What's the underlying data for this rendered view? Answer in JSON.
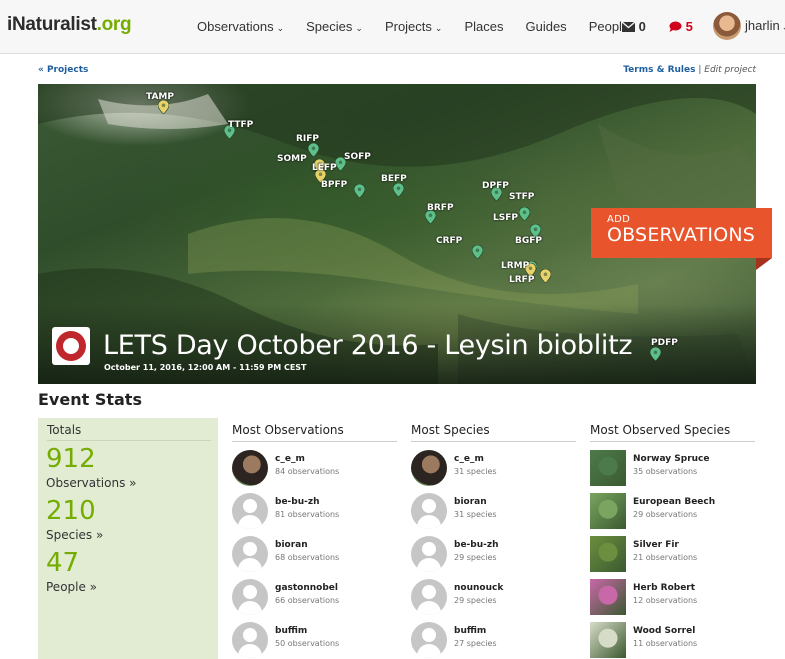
{
  "nav": {
    "logo_main": "iNaturalist",
    "logo_org": ".org",
    "menu": [
      {
        "label": "Observations",
        "dropdown": true
      },
      {
        "label": "Species",
        "dropdown": true
      },
      {
        "label": "Projects",
        "dropdown": true
      },
      {
        "label": "Places",
        "dropdown": false
      },
      {
        "label": "Guides",
        "dropdown": false
      },
      {
        "label": "People",
        "dropdown": false
      }
    ],
    "messages_count": "0",
    "notifications_count": "5",
    "username": "jharlin",
    "caret": "⌄"
  },
  "subnav": {
    "back_link": "« Projects",
    "terms": "Terms & Rules",
    "separator": "|",
    "edit": "Edit project"
  },
  "banner": {
    "pins": [
      {
        "label": "TAMP",
        "color": "#e8d36a"
      },
      {
        "label": "TTFP",
        "color": "#5fbf8a"
      },
      {
        "label": "RIFP",
        "color": "#5fbf8a"
      },
      {
        "label": "SOMP",
        "color": "#e8d36a"
      },
      {
        "label": "SOFP",
        "color": "#5fbf8a"
      },
      {
        "label": "LEFP",
        "color": "#e8d36a"
      },
      {
        "label": "BPFP",
        "color": "#5fbf8a"
      },
      {
        "label": "BEFP",
        "color": "#5fbf8a"
      },
      {
        "label": "DPFP",
        "color": "#5fbf8a"
      },
      {
        "label": "STFP",
        "color": "#5fbf8a"
      },
      {
        "label": "BRFP",
        "color": "#5fbf8a"
      },
      {
        "label": "LSFP",
        "color": "#5fbf8a"
      },
      {
        "label": "BGFP",
        "color": "#5fbf8a"
      },
      {
        "label": "CRFP",
        "color": "#5fbf8a"
      },
      {
        "label": "LRMP",
        "color": "#e8d36a"
      },
      {
        "label": "LRFP",
        "color": "#e8d36a"
      },
      {
        "label": "PDFP",
        "color": "#5fbf8a"
      }
    ],
    "add_line1": "ADD",
    "add_line2": "OBSERVATIONS",
    "title": "LETS Day October 2016 - Leysin bioblitz",
    "date": "October 11, 2016, 12:00 AM - 11:59 PM CEST"
  },
  "stats": {
    "heading": "Event Stats",
    "totals": {
      "header": "Totals",
      "observations_num": "912",
      "observations_label": "Observations »",
      "species_num": "210",
      "species_label": "Species »",
      "people_num": "47",
      "people_label": "People »"
    },
    "most_observations": {
      "header": "Most Observations",
      "rows": [
        {
          "name": "c_e_m",
          "sub": "84 observations",
          "photo": true
        },
        {
          "name": "be-bu-zh",
          "sub": "81 observations",
          "photo": false
        },
        {
          "name": "bioran",
          "sub": "68 observations",
          "photo": false
        },
        {
          "name": "gastonnobel",
          "sub": "66 observations",
          "photo": false
        },
        {
          "name": "buffim",
          "sub": "50 observations",
          "photo": false
        }
      ]
    },
    "most_species": {
      "header": "Most Species",
      "rows": [
        {
          "name": "c_e_m",
          "sub": "31 species",
          "photo": true
        },
        {
          "name": "bioran",
          "sub": "31 species",
          "photo": false
        },
        {
          "name": "be-bu-zh",
          "sub": "29 species",
          "photo": false
        },
        {
          "name": "nounouck",
          "sub": "29 species",
          "photo": false
        },
        {
          "name": "buffim",
          "sub": "27 species",
          "photo": false
        }
      ]
    },
    "most_observed_species": {
      "header": "Most Observed Species",
      "rows": [
        {
          "name": "Norway Spruce",
          "sub": "35 observations",
          "color": "#4d7a4a"
        },
        {
          "name": "European Beech",
          "sub": "29 observations",
          "color": "#7aa560"
        },
        {
          "name": "Silver Fir",
          "sub": "21 observations",
          "color": "#6b8e3f"
        },
        {
          "name": "Herb Robert",
          "sub": "12 observations",
          "color": "#c968a8"
        },
        {
          "name": "Wood Sorrel",
          "sub": "11 observations",
          "color": "#d7dcc8"
        }
      ]
    }
  }
}
